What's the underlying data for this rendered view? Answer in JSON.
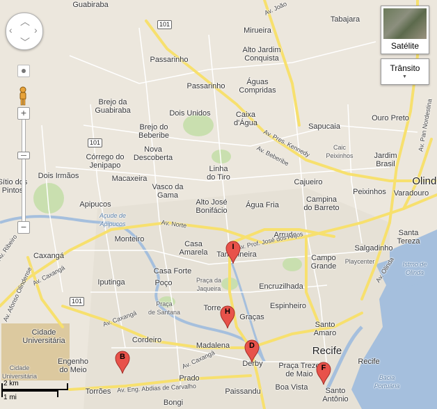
{
  "places": {
    "guabiraba": "Guabiraba",
    "mirueira": "Mirueira",
    "tabajara": "Tabajara",
    "passarinho1": "Passarinho",
    "alto_jardim": "Alto Jardim\nConquista",
    "passarinho2": "Passarinho",
    "aguas_compridas": "Águas\nCompridas",
    "brejo_guabiraba": "Brejo da\nGuabiraba",
    "dois_unidos": "Dois Unidos",
    "caixa_dagua": "Caixa\nd'Água",
    "sapucaia": "Sapucaia",
    "ouro_preto": "Ouro Preto",
    "brejo_beberibe": "Brejo do\nBeberibe",
    "caic": "Caic\nPeixinhos",
    "nova_descoberta": "Nova\nDescoberta",
    "corrego_jenipapo": "Córrego do\nJenipapo",
    "jardim_brasil": "Jardim\nBrasil",
    "dois_irmaos": "Dois Irmãos",
    "sitio_pintos": "Sítio dos\nPintos",
    "macaxeira": "Macaxeira",
    "vasco_gama": "Vasco da\nGama",
    "linha_tiro": "Linha\ndo Tiro",
    "cajueiro": "Cajueiro",
    "peixinhos": "Peixinhos",
    "varadouro": "Varadouro",
    "olinda": "Olinda",
    "apipucos": "Apipucos",
    "alto_jose": "Alto José\nBonifácio",
    "agua_fria": "Água Fria",
    "campina": "Campina\ndo Barreto",
    "acude": "Açude de\nApipucos",
    "monteiro": "Monteiro",
    "arruda": "Arruda",
    "santa_tereza": "Santa\nTereza",
    "casa_amarela": "Casa\nAmarela",
    "tamarineira": "Tamarineira",
    "salgadinho": "Salgadinho",
    "caxang": "Caxangá",
    "campo_grande": "Campo\nGrande",
    "playcenter": "Playcenter",
    "istmo": "Istmo de\nOlinda",
    "casa_forte": "Casa Forte",
    "ipitanga": "Iputinga",
    "poco": "Poço",
    "praca_jaqueira": "Praça da\nJaqueira",
    "encruzilhada": "Encruzilhada",
    "praca_santana": "Praça\nde Santana",
    "torre": "Torre",
    "gracas": "Graças",
    "espinheiro": "Espinheiro",
    "cidade_univ": "Cidade\nUniversitária",
    "cordeiro": "Cordeiro",
    "santo_amaro": "Santo\nAmaro",
    "recife": "Recife",
    "madalena": "Madalena",
    "engenho_meio": "Engenho\ndo Meio",
    "cidade_univ2": "Cidade\nUniversitária",
    "derby": "Derby",
    "praca_treze": "Praça Treze\nde Maio",
    "recife2": "Recife",
    "bacia": "Bacia\nPortuária",
    "prado": "Prado",
    "torroes": "Torrões",
    "boa_vista": "Boa Vista",
    "paissandu": "Paissandu",
    "santo_antonio": "Santo\nAntônio",
    "bongi": "Bongi"
  },
  "roads": {
    "av_norte": "Av. Norte",
    "av_beberibe": "Av. Beberibe",
    "av_pres_kennedy": "Av. Pres. Kennedy",
    "av_prof_jose": "Av. Prof. José dos Anjos",
    "av_caxanga1": "Av. Caxangá",
    "av_caxanga2": "Av. Caxangá",
    "av_caxanga3": "Av. Caxangá",
    "av_olinda": "Av. Olinda",
    "av_pan_nordestina": "Av. Pan Nordestina",
    "av_joao": "Av. João",
    "av_ribeiro": "Av. Ribeiro",
    "av_afonso": "Av. Afonso Olindense",
    "av_abdias": "Av. Eng. Abdias de Carvalho"
  },
  "shields": [
    "101",
    "101",
    "101"
  ],
  "markers": [
    "I",
    "H",
    "D",
    "B",
    "F"
  ],
  "controls": {
    "satellite_label": "Satélite",
    "traffic_label": "Trânsito",
    "scale_km": "2 km",
    "scale_mi": "1 mi"
  },
  "colors": {
    "land": "#ece7dd",
    "water": "#a5bfdd",
    "park": "#c9dfaf",
    "major_road": "#f7e06e",
    "minor_road": "#ffffff",
    "marker": "#e8524a"
  },
  "icons": {
    "pegman": "pegman-icon",
    "pan": "pan-control-icon",
    "zoom_in": "zoom-in-icon",
    "zoom_out": "zoom-out-icon",
    "dropdown": "chevron-down-icon"
  }
}
